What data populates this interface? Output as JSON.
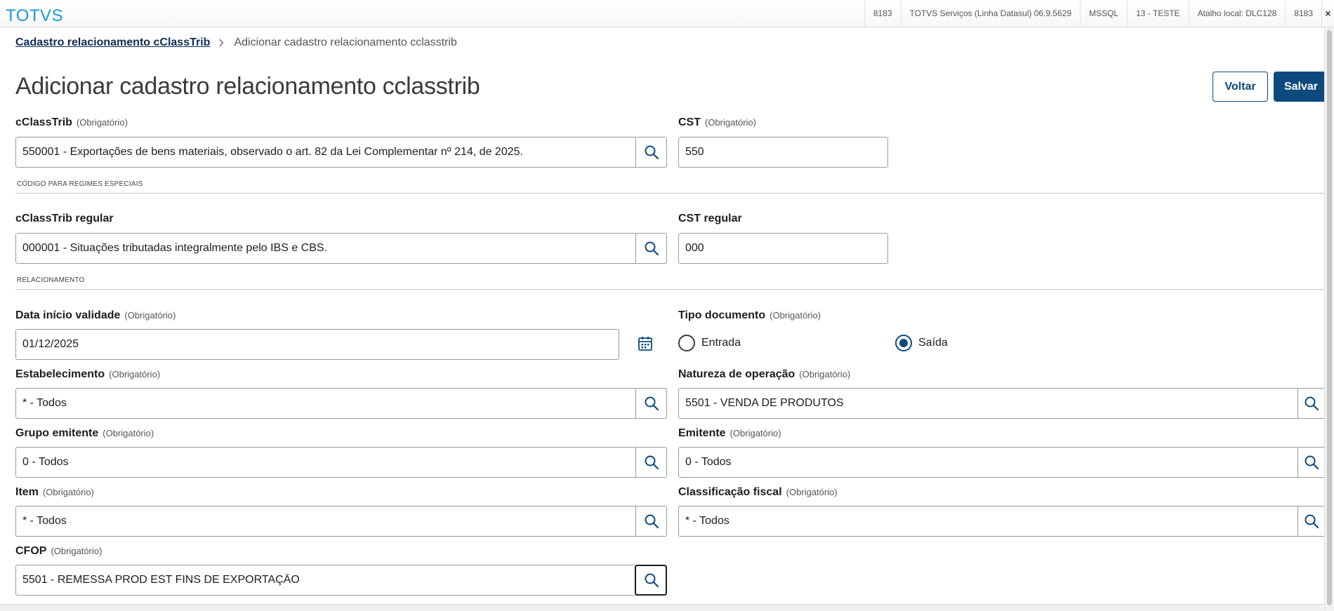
{
  "header": {
    "logo": "TOTVS",
    "status": [
      "8183",
      "TOTVS Serviços (Linha Datasul) 06.9.5629",
      "MSSQL",
      "13 - TESTE",
      "Atalho local: DLC128",
      "8183"
    ],
    "close": "×"
  },
  "breadcrumb": {
    "parent": "Cadastro relacionamento cClassTrib",
    "current": "Adicionar cadastro relacionamento cclasstrib"
  },
  "page": {
    "title": "Adicionar cadastro relacionamento cclasstrib",
    "back_label": "Voltar",
    "save_label": "Salvar"
  },
  "required_text": "(Obrigatório)",
  "sections": {
    "special": "CÓDIGO PARA REGIMES ESPECIAIS",
    "relation": "RELACIONAMENTO"
  },
  "fields": {
    "cclasstrib": {
      "label": "cClassTrib",
      "value": "550001 - Exportações de bens materiais, observado o art. 82 da Lei Complementar nº 214, de 2025."
    },
    "cst": {
      "label": "CST",
      "value": "550"
    },
    "cclasstrib_regular": {
      "label": "cClassTrib regular",
      "value": "000001 - Situações tributadas integralmente pelo IBS e CBS."
    },
    "cst_regular": {
      "label": "CST regular",
      "value": "000"
    },
    "data_inicio": {
      "label": "Data início validade",
      "value": "01/12/2025"
    },
    "tipo_documento": {
      "label": "Tipo documento",
      "options": [
        "Entrada",
        "Saída"
      ],
      "selected": "Saída"
    },
    "estabelecimento": {
      "label": "Estabelecimento",
      "value": "* - Todos"
    },
    "natureza": {
      "label": "Natureza de operação",
      "value": "5501 - VENDA DE PRODUTOS"
    },
    "grupo_emitente": {
      "label": "Grupo emitente",
      "value": "0 - Todos"
    },
    "emitente": {
      "label": "Emitente",
      "value": "0 - Todos"
    },
    "item": {
      "label": "Item",
      "value": "* - Todos"
    },
    "classificacao": {
      "label": "Classificação fiscal",
      "value": "* - Todos"
    },
    "cfop": {
      "label": "CFOP",
      "value": "5501 - REMESSA PROD EST FINS DE EXPORTAÇÃO"
    }
  },
  "colors": {
    "brand": "#1a9bd7",
    "primary": "#0c4a7d",
    "breadcrumb": "#0c2b52"
  },
  "icons": {
    "lookup": "search-icon",
    "calendar": "calendar-icon",
    "separator": "chevron-right-icon",
    "close": "close-icon"
  }
}
